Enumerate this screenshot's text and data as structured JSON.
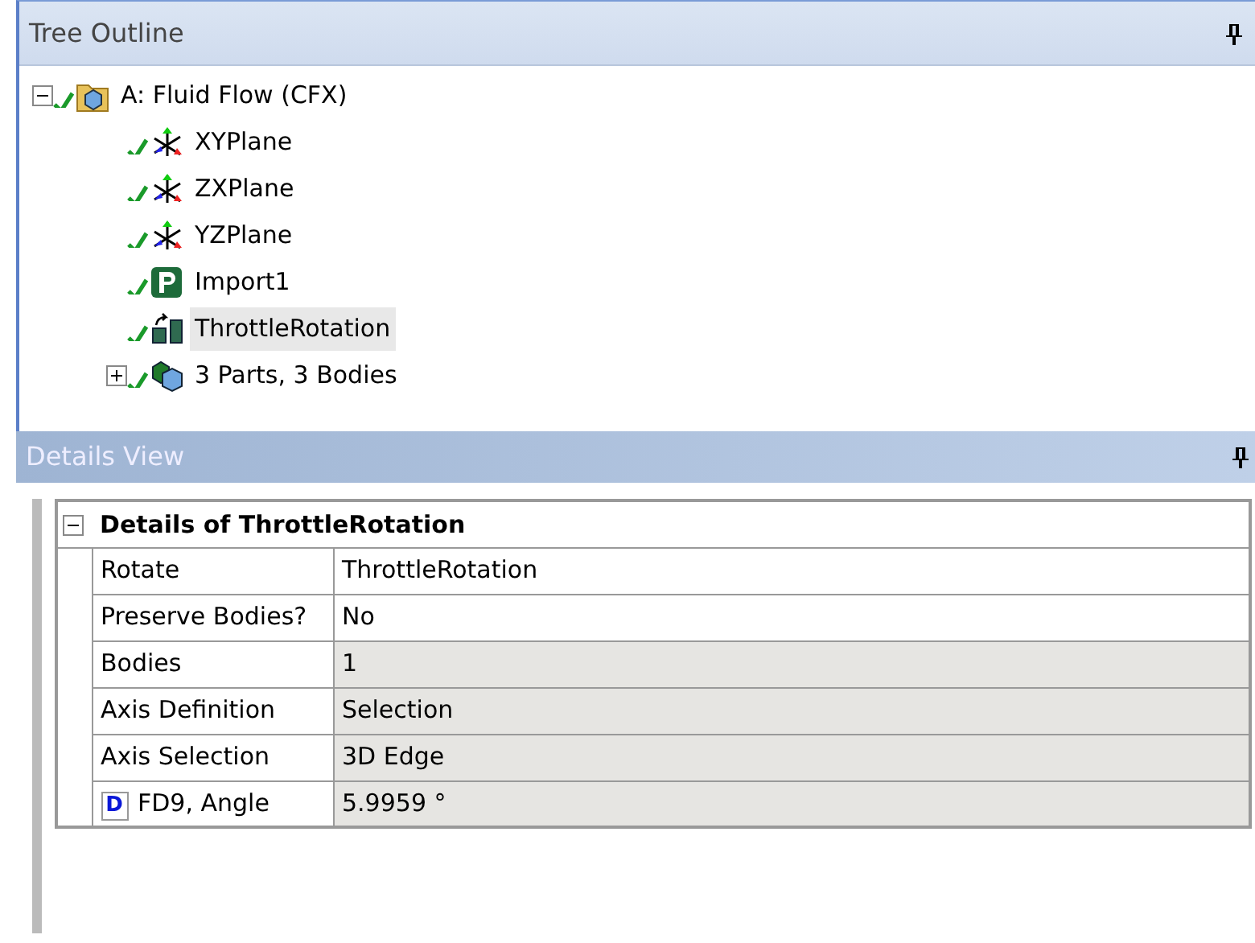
{
  "tree_outline": {
    "title": "Tree Outline",
    "items": [
      {
        "label": "A: Fluid Flow (CFX)",
        "kind": "project",
        "expanded": true,
        "selected": false,
        "children": [
          {
            "label": "XYPlane",
            "kind": "plane",
            "selected": false
          },
          {
            "label": "ZXPlane",
            "kind": "plane",
            "selected": false
          },
          {
            "label": "YZPlane",
            "kind": "plane",
            "selected": false
          },
          {
            "label": "Import1",
            "kind": "import",
            "selected": false
          },
          {
            "label": "ThrottleRotation",
            "kind": "rotate",
            "selected": true
          },
          {
            "label": "3 Parts, 3 Bodies",
            "kind": "bodies",
            "expanded": false,
            "selected": false
          }
        ]
      }
    ]
  },
  "details_view": {
    "title": "Details View",
    "heading": "Details of ThrottleRotation",
    "expanded": true,
    "rows": [
      {
        "name": "Rotate",
        "value": "ThrottleRotation",
        "editable": true
      },
      {
        "name": "Preserve Bodies?",
        "value": "No",
        "editable": true
      },
      {
        "name": "Bodies",
        "value": "1",
        "editable": false
      },
      {
        "name": "Axis Definition",
        "value": "Selection",
        "editable": false
      },
      {
        "name": "Axis Selection",
        "value": "3D Edge",
        "editable": false
      },
      {
        "name": "FD9, Angle",
        "value": "5.9959 °",
        "editable": false,
        "badge": "D"
      }
    ]
  }
}
